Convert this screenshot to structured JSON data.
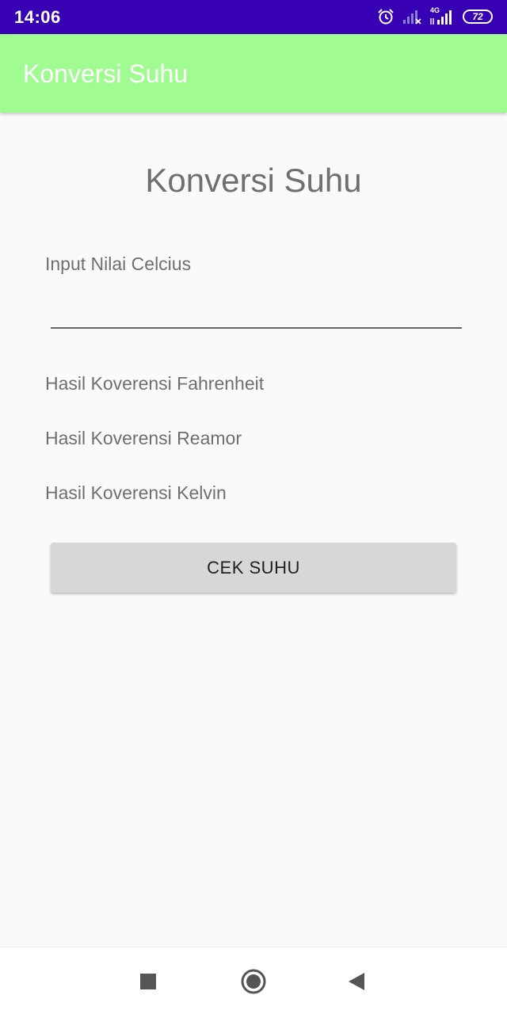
{
  "status_bar": {
    "time": "14:06",
    "network_type": "4G",
    "battery_level": "72",
    "icons": [
      "alarm-icon",
      "signal-weak-icon",
      "signal-4g-icon",
      "battery-icon"
    ],
    "background_color": "#3700b3"
  },
  "app_bar": {
    "title": "Konversi Suhu",
    "background_color": "#a0fb90"
  },
  "main": {
    "heading": "Konversi Suhu",
    "input_label": "Input Nilai Celcius",
    "input_value": "",
    "input_placeholder": "",
    "result_fahrenheit": "Hasil Koverensi Fahrenheit",
    "result_reamur": "Hasil Koverensi Reamor",
    "result_kelvin": "Hasil Koverensi Kelvin",
    "button_label": "CEK SUHU"
  },
  "nav_bar": {
    "buttons": [
      "recents-square-icon",
      "home-circle-icon",
      "back-triangle-icon"
    ]
  }
}
